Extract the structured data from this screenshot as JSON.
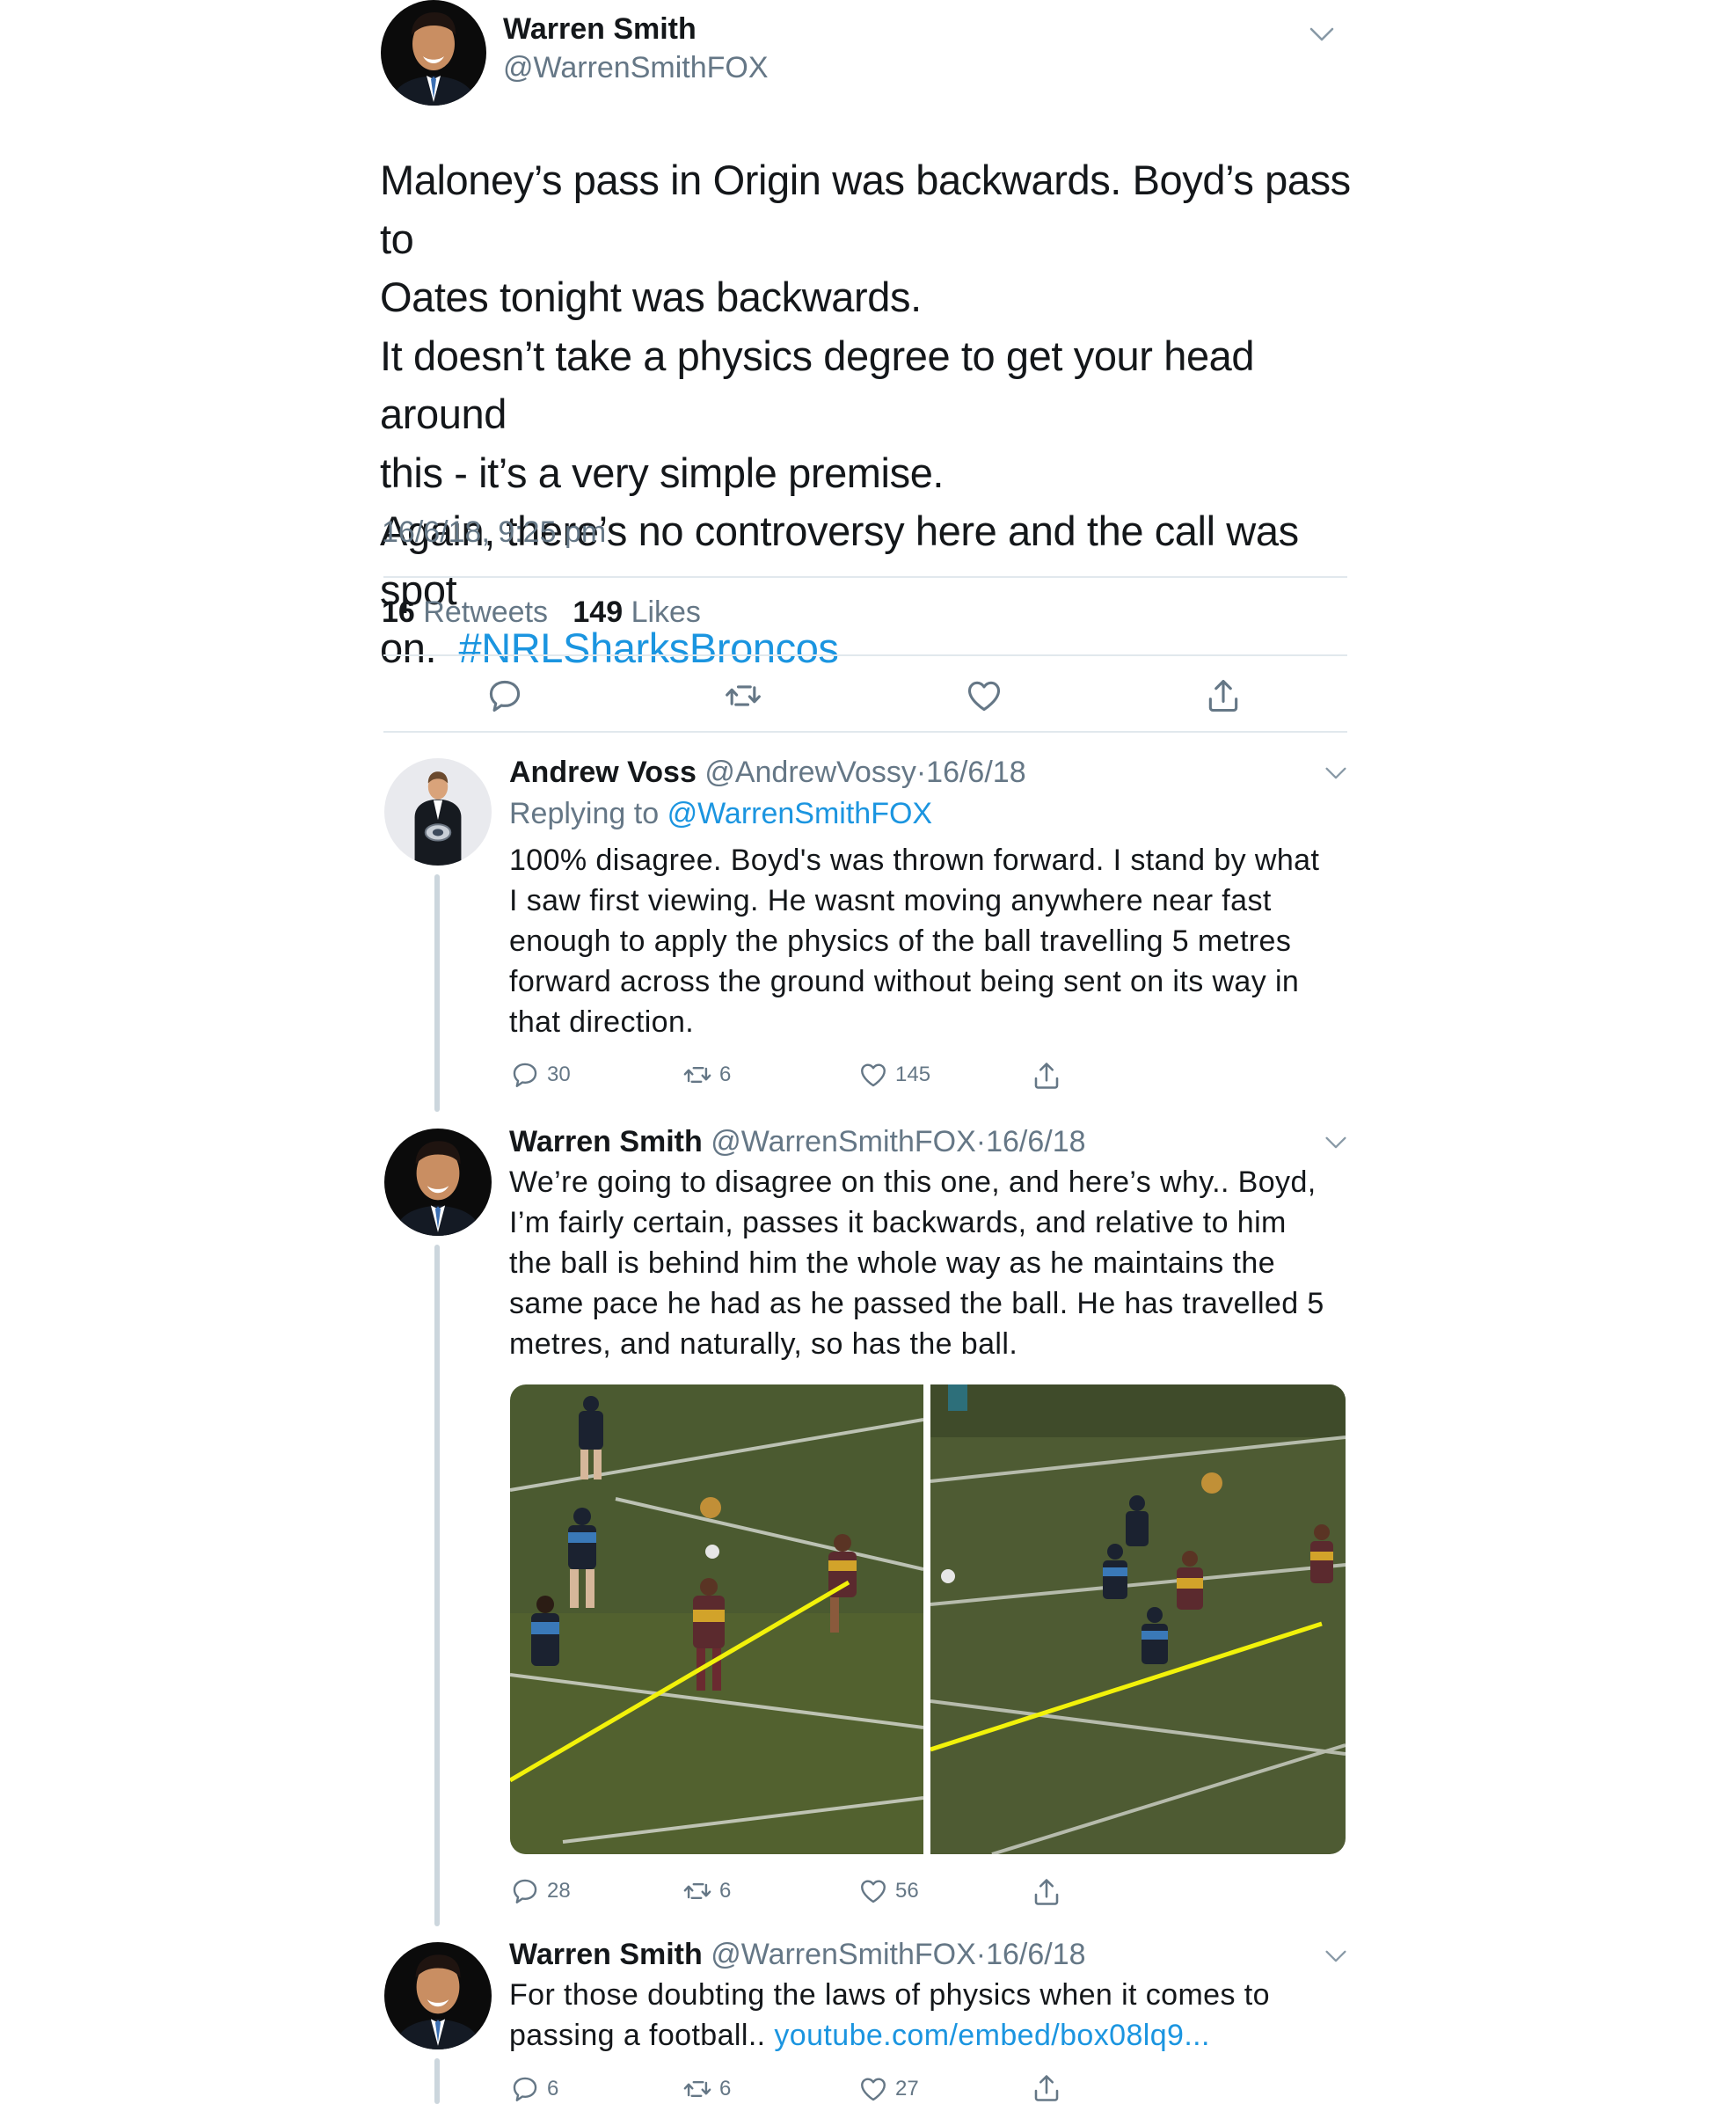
{
  "main_tweet": {
    "author_name": "Warren Smith",
    "author_handle": "@WarrenSmithFOX",
    "text_lines": [
      "Maloney’s pass in Origin was backwards. Boyd’s pass to",
      "Oates tonight was backwards.",
      "It doesn’t take a physics degree to get your head around",
      "this - it’s a very simple premise.",
      "Again, there’s no controversy here and the call was spot"
    ],
    "last_line_prefix": "on.",
    "hashtag": "#NRLSharksBroncos",
    "timestamp": "16/6/18, 9:25 pm",
    "retweet_count": "16",
    "retweet_label": "Retweets",
    "like_count": "149",
    "like_label": "Likes",
    "actions": [
      "reply-icon",
      "retweet-icon",
      "like-icon",
      "share-icon"
    ]
  },
  "replies": [
    {
      "author_name": "Andrew Voss",
      "author_handle": "@AndrewVossy",
      "separator": "·",
      "date": "16/6/18",
      "replying_prefix": "Replying to",
      "replying_handle": "@WarrenSmithFOX",
      "text_lines": [
        "100% disagree. Boyd's was thrown forward. I stand by what",
        "I saw first viewing. He wasnt moving anywhere near fast",
        "enough to apply the physics of the ball  travelling 5 metres",
        "forward across the ground without being sent on its way in",
        "that direction."
      ],
      "reply_count": "30",
      "retweet_count": "6",
      "like_count": "145"
    },
    {
      "author_name": "Warren Smith",
      "author_handle": "@WarrenSmithFOX",
      "separator": "·",
      "date": "16/6/18",
      "text_lines": [
        "We’re going to disagree on this one, and here’s why.. Boyd,",
        "I’m fairly certain, passes it backwards, and relative to him",
        "the ball is behind him the whole way as he maintains the",
        "same pace he had as he passed the ball. He has travelled 5",
        "metres, and naturally, so has the ball."
      ],
      "media": [
        "rugby-league-pass-frame-1",
        "rugby-league-pass-frame-2"
      ],
      "reply_count": "28",
      "retweet_count": "6",
      "like_count": "56"
    },
    {
      "author_name": "Warren Smith",
      "author_handle": "@WarrenSmithFOX",
      "separator": "·",
      "date": "16/6/18",
      "text_line1": "For those doubting the laws of physics when it comes to",
      "text_line2_prefix": "passing a football..",
      "link": "youtube.com/embed/box08lq9...",
      "reply_count": "6",
      "retweet_count": "6",
      "like_count": "27"
    }
  ],
  "colors": {
    "text": "#14171a",
    "secondary": "#657786",
    "link": "#1b95e0",
    "divider": "#e1e8ed",
    "thread_line": "#ccd6dd",
    "annotation_line": "#f2f20a",
    "field_grass": "#4a5a2e"
  }
}
